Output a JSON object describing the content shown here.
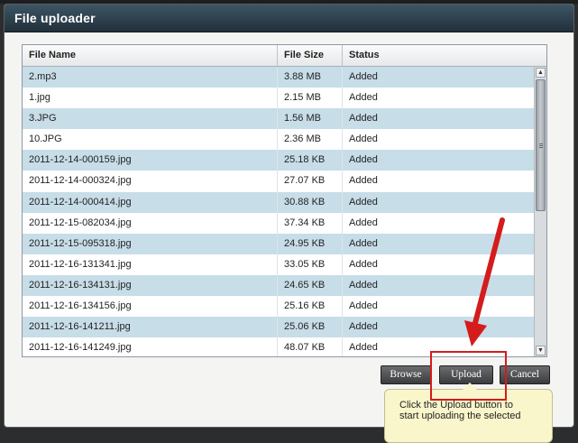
{
  "window": {
    "title": "File uploader"
  },
  "grid": {
    "columns": [
      "File Name",
      "File Size",
      "Status"
    ],
    "rows": [
      {
        "name": "2.mp3",
        "size": "3.88 MB",
        "status": "Added"
      },
      {
        "name": "1.jpg",
        "size": "2.15 MB",
        "status": "Added"
      },
      {
        "name": "3.JPG",
        "size": "1.56 MB",
        "status": "Added"
      },
      {
        "name": "10.JPG",
        "size": "2.36 MB",
        "status": "Added"
      },
      {
        "name": "2011-12-14-000159.jpg",
        "size": "25.18 KB",
        "status": "Added"
      },
      {
        "name": "2011-12-14-000324.jpg",
        "size": "27.07 KB",
        "status": "Added"
      },
      {
        "name": "2011-12-14-000414.jpg",
        "size": "30.88 KB",
        "status": "Added"
      },
      {
        "name": "2011-12-15-082034.jpg",
        "size": "37.34 KB",
        "status": "Added"
      },
      {
        "name": "2011-12-15-095318.jpg",
        "size": "24.95 KB",
        "status": "Added"
      },
      {
        "name": "2011-12-16-131341.jpg",
        "size": "33.05 KB",
        "status": "Added"
      },
      {
        "name": "2011-12-16-134131.jpg",
        "size": "24.65 KB",
        "status": "Added"
      },
      {
        "name": "2011-12-16-134156.jpg",
        "size": "25.16 KB",
        "status": "Added"
      },
      {
        "name": "2011-12-16-141211.jpg",
        "size": "25.06 KB",
        "status": "Added"
      },
      {
        "name": "2011-12-16-141249.jpg",
        "size": "48.07 KB",
        "status": "Added"
      }
    ]
  },
  "buttons": {
    "browse": "Browse",
    "upload": "Upload",
    "cancel": "Cancel"
  },
  "tooltip": {
    "line1": "Click the Upload button to",
    "line2": "start uploading the selected"
  },
  "icons": {
    "scroll_up": "scroll-up-arrow-icon",
    "scroll_down": "scroll-down-arrow-icon"
  },
  "colors": {
    "annotation": "#d41c1c",
    "row_alt": "#c7dde8",
    "titlebar": "#2f4150"
  }
}
